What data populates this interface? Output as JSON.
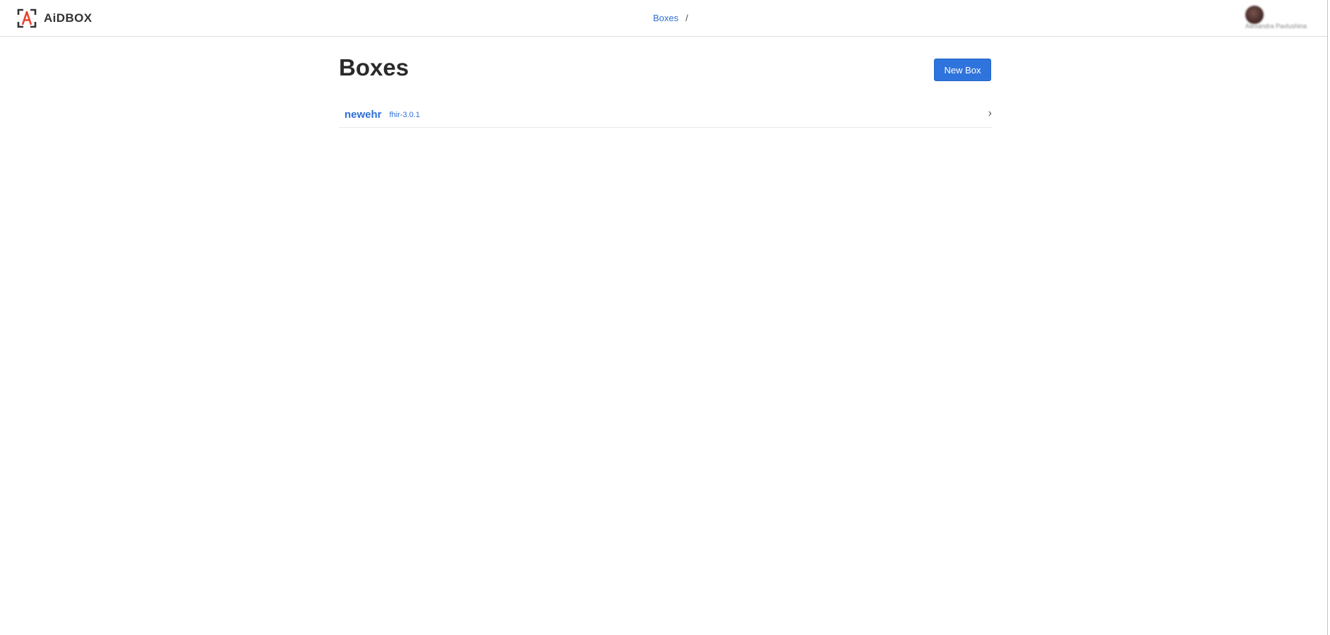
{
  "brand": {
    "name": "AiDBOX",
    "logo_letter": "A",
    "accent_color": "#e8442f"
  },
  "breadcrumb": {
    "items": [
      "Boxes"
    ],
    "separator": "/"
  },
  "user": {
    "name": "Alexandra Pavlushina"
  },
  "main": {
    "title": "Boxes",
    "new_box_label": "New Box",
    "boxes": [
      {
        "name": "newehr",
        "version": "fhir-3.0.1"
      }
    ]
  },
  "icons": {
    "chevron": "›"
  },
  "colors": {
    "primary": "#2f74dc",
    "link": "#2f6fd6"
  }
}
